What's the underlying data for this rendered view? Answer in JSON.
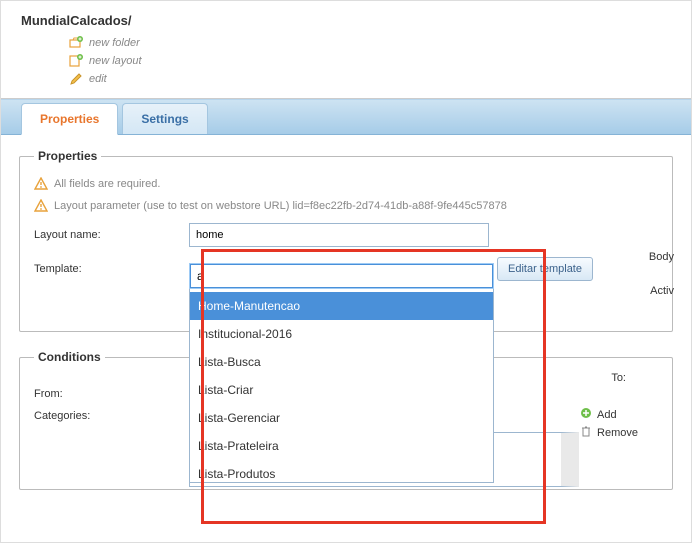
{
  "breadcrumb": "MundialCalcados/",
  "top_actions": {
    "new_folder": "new folder",
    "new_layout": "new layout",
    "edit": "edit"
  },
  "tabs": {
    "properties": "Properties",
    "settings": "Settings"
  },
  "properties": {
    "legend": "Properties",
    "required_msg": "All fields are required.",
    "lid_msg": "Layout parameter (use to test on webstore URL) lid=f8ec22fb-2d74-41db-a88f-9fe445c57878",
    "layout_name_label": "Layout name:",
    "layout_name_value": "home",
    "template_label": "Template:",
    "template_search": "a",
    "editar_btn": "Editar template",
    "body_class": "Body",
    "active": "Activ",
    "options": [
      "Home-Manutencao",
      "Institucional-2016",
      "Lista-Busca",
      "Lista-Criar",
      "Lista-Gerenciar",
      "Lista-Prateleira",
      "Lista-Produtos"
    ]
  },
  "conditions": {
    "legend": "Conditions",
    "from": "From:",
    "to": "To:",
    "categories": "Categories:",
    "add": "Add",
    "remove": "Remove"
  }
}
